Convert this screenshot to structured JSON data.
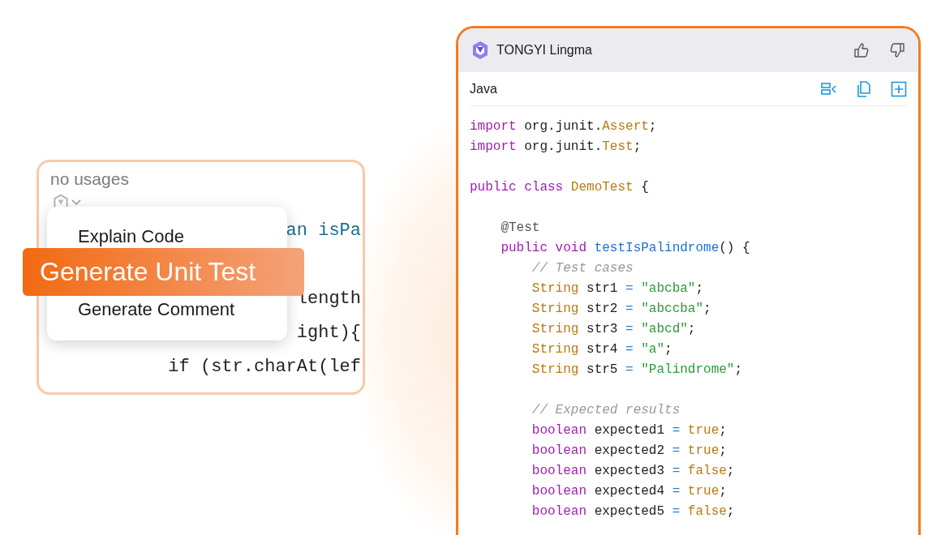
{
  "editor_popup": {
    "hint": "no usages",
    "code_lines": [
      {
        "kind": "code",
        "text": "an isPa"
      },
      {
        "kind": "blank"
      },
      {
        "kind": "code",
        "text": "length"
      },
      {
        "kind": "code",
        "text": "ight){"
      },
      {
        "kind": "code",
        "text": "if (str.charAt(lef"
      }
    ],
    "menu": {
      "items": [
        {
          "label": "Explain Code",
          "selected": false
        },
        {
          "label": "Generate Unit Test",
          "selected": true
        },
        {
          "label": "Generate Comment",
          "selected": false
        }
      ]
    }
  },
  "assistant_panel": {
    "title": "TONGYI Lingma",
    "language": "Java",
    "code": [
      {
        "kind": "code",
        "tokens": [
          {
            "text": "import ",
            "kind": "keyword"
          },
          {
            "text": "org.junit.",
            "kind": "plain"
          },
          {
            "text": "Assert",
            "kind": "type"
          },
          {
            "text": ";",
            "kind": "plain"
          }
        ]
      },
      {
        "kind": "code",
        "tokens": [
          {
            "text": "import ",
            "kind": "keyword"
          },
          {
            "text": "org.junit.",
            "kind": "plain"
          },
          {
            "text": "Test",
            "kind": "type"
          },
          {
            "text": ";",
            "kind": "plain"
          }
        ]
      },
      {
        "kind": "blank"
      },
      {
        "kind": "code",
        "tokens": [
          {
            "text": "public class ",
            "kind": "keyword"
          },
          {
            "text": "DemoTest",
            "kind": "type"
          },
          {
            "text": " {",
            "kind": "plain"
          }
        ]
      },
      {
        "kind": "blank"
      },
      {
        "kind": "code",
        "tokens": [
          {
            "text": "    @Test",
            "kind": "annotation"
          }
        ]
      },
      {
        "kind": "code",
        "tokens": [
          {
            "text": "    public void ",
            "kind": "keyword"
          },
          {
            "text": "testIsPalindrome",
            "kind": "method"
          },
          {
            "text": "() {",
            "kind": "plain"
          }
        ]
      },
      {
        "kind": "code",
        "tokens": [
          {
            "text": "        // Test cases",
            "kind": "comment"
          }
        ]
      },
      {
        "kind": "code",
        "tokens": [
          {
            "text": "        String ",
            "kind": "type"
          },
          {
            "text": "str1 ",
            "kind": "plain"
          },
          {
            "text": "= ",
            "kind": "operator"
          },
          {
            "text": "\"abcba\"",
            "kind": "string"
          },
          {
            "text": ";",
            "kind": "plain"
          }
        ]
      },
      {
        "kind": "code",
        "tokens": [
          {
            "text": "        String ",
            "kind": "type"
          },
          {
            "text": "str2 ",
            "kind": "plain"
          },
          {
            "text": "= ",
            "kind": "operator"
          },
          {
            "text": "\"abccba\"",
            "kind": "string"
          },
          {
            "text": ";",
            "kind": "plain"
          }
        ]
      },
      {
        "kind": "code",
        "tokens": [
          {
            "text": "        String ",
            "kind": "type"
          },
          {
            "text": "str3 ",
            "kind": "plain"
          },
          {
            "text": "= ",
            "kind": "operator"
          },
          {
            "text": "\"abcd\"",
            "kind": "string"
          },
          {
            "text": ";",
            "kind": "plain"
          }
        ]
      },
      {
        "kind": "code",
        "tokens": [
          {
            "text": "        String ",
            "kind": "type"
          },
          {
            "text": "str4 ",
            "kind": "plain"
          },
          {
            "text": "= ",
            "kind": "operator"
          },
          {
            "text": "\"a\"",
            "kind": "string"
          },
          {
            "text": ";",
            "kind": "plain"
          }
        ]
      },
      {
        "kind": "code",
        "tokens": [
          {
            "text": "        String ",
            "kind": "type"
          },
          {
            "text": "str5 ",
            "kind": "plain"
          },
          {
            "text": "= ",
            "kind": "operator"
          },
          {
            "text": "\"Palindrome\"",
            "kind": "string"
          },
          {
            "text": ";",
            "kind": "plain"
          }
        ]
      },
      {
        "kind": "blank"
      },
      {
        "kind": "code",
        "tokens": [
          {
            "text": "        // Expected results",
            "kind": "comment"
          }
        ]
      },
      {
        "kind": "code",
        "tokens": [
          {
            "text": "        boolean ",
            "kind": "keyword"
          },
          {
            "text": "expected1 ",
            "kind": "plain"
          },
          {
            "text": "= ",
            "kind": "operator"
          },
          {
            "text": "true",
            "kind": "type"
          },
          {
            "text": ";",
            "kind": "plain"
          }
        ]
      },
      {
        "kind": "code",
        "tokens": [
          {
            "text": "        boolean ",
            "kind": "keyword"
          },
          {
            "text": "expected2 ",
            "kind": "plain"
          },
          {
            "text": "= ",
            "kind": "operator"
          },
          {
            "text": "true",
            "kind": "type"
          },
          {
            "text": ";",
            "kind": "plain"
          }
        ]
      },
      {
        "kind": "code",
        "tokens": [
          {
            "text": "        boolean ",
            "kind": "keyword"
          },
          {
            "text": "expected3 ",
            "kind": "plain"
          },
          {
            "text": "= ",
            "kind": "operator"
          },
          {
            "text": "false",
            "kind": "type"
          },
          {
            "text": ";",
            "kind": "plain"
          }
        ]
      },
      {
        "kind": "code",
        "tokens": [
          {
            "text": "        boolean ",
            "kind": "keyword"
          },
          {
            "text": "expected4 ",
            "kind": "plain"
          },
          {
            "text": "= ",
            "kind": "operator"
          },
          {
            "text": "true",
            "kind": "type"
          },
          {
            "text": ";",
            "kind": "plain"
          }
        ]
      },
      {
        "kind": "code",
        "tokens": [
          {
            "text": "        boolean ",
            "kind": "keyword"
          },
          {
            "text": "expected5 ",
            "kind": "plain"
          },
          {
            "text": "= ",
            "kind": "operator"
          },
          {
            "text": "false",
            "kind": "type"
          },
          {
            "text": ";",
            "kind": "plain"
          }
        ]
      }
    ]
  }
}
